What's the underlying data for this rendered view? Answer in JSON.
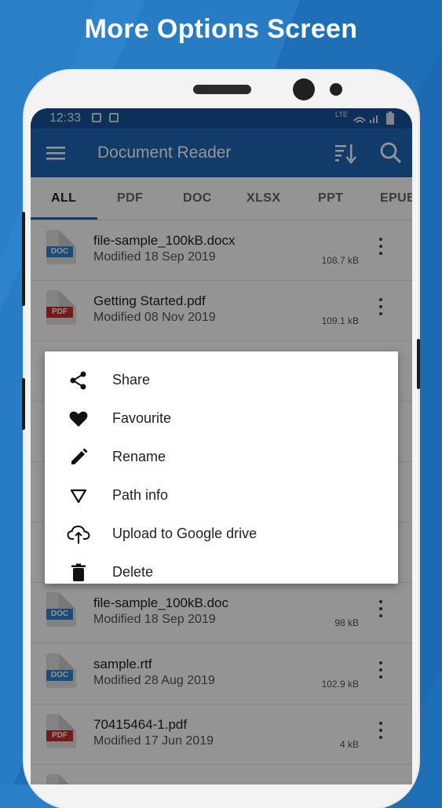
{
  "headline": "More Options Screen",
  "status_bar": {
    "time": "12:33",
    "network": "LTE"
  },
  "app_bar": {
    "title": "Document Reader",
    "menu_icon": "hamburger-menu-icon",
    "sort_icon": "sort-icon",
    "search_icon": "search-icon"
  },
  "tabs": [
    "ALL",
    "PDF",
    "DOC",
    "XLSX",
    "PPT",
    "EPUB"
  ],
  "active_tab": "ALL",
  "files": [
    {
      "name": "file-sample_100kB.docx",
      "modified": "Modified 18 Sep 2019",
      "size": "108.7 kB",
      "type": "DOC"
    },
    {
      "name": "Getting Started.pdf",
      "modified": "Modified 08 Nov 2019",
      "size": "109.1 kB",
      "type": "PDF"
    },
    {
      "name": "file-sample_100kB.doc",
      "modified": "Modified 18 Sep 2019",
      "size": "98 kB",
      "type": "DOC"
    },
    {
      "name": "sample.rtf",
      "modified": "Modified 28 Aug 2019",
      "size": "102.9 kB",
      "type": "DOC"
    },
    {
      "name": "70415464-1.pdf",
      "modified": "Modified 17 Jun 2019",
      "size": "4 kB",
      "type": "PDF"
    }
  ],
  "more_options_menu": [
    {
      "label": "Share",
      "icon": "share-icon"
    },
    {
      "label": "Favourite",
      "icon": "heart-icon"
    },
    {
      "label": "Rename",
      "icon": "pencil-icon"
    },
    {
      "label": "Path info",
      "icon": "triangle-down-icon"
    },
    {
      "label": "Upload to Google drive",
      "icon": "cloud-upload-icon"
    },
    {
      "label": "Delete",
      "icon": "trash-icon"
    }
  ],
  "colors": {
    "app_bar": "#1e67b3",
    "status_bar": "#17549b",
    "doc_tag": "#2f86cf",
    "pdf_tag": "#c9302c"
  }
}
